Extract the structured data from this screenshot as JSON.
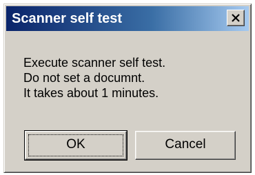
{
  "window": {
    "title": "Scanner self test"
  },
  "message": {
    "lines": [
      "Execute scanner self test.",
      "Do not set a documnt.",
      "It takes about 1 minutes."
    ]
  },
  "buttons": {
    "ok_label": "OK",
    "cancel_label": "Cancel"
  },
  "icons": {
    "close": "close-icon"
  },
  "colors": {
    "titlebar_start": "#0a246a",
    "titlebar_end": "#a6caf0",
    "dialog_bg": "#d4d0c8"
  }
}
